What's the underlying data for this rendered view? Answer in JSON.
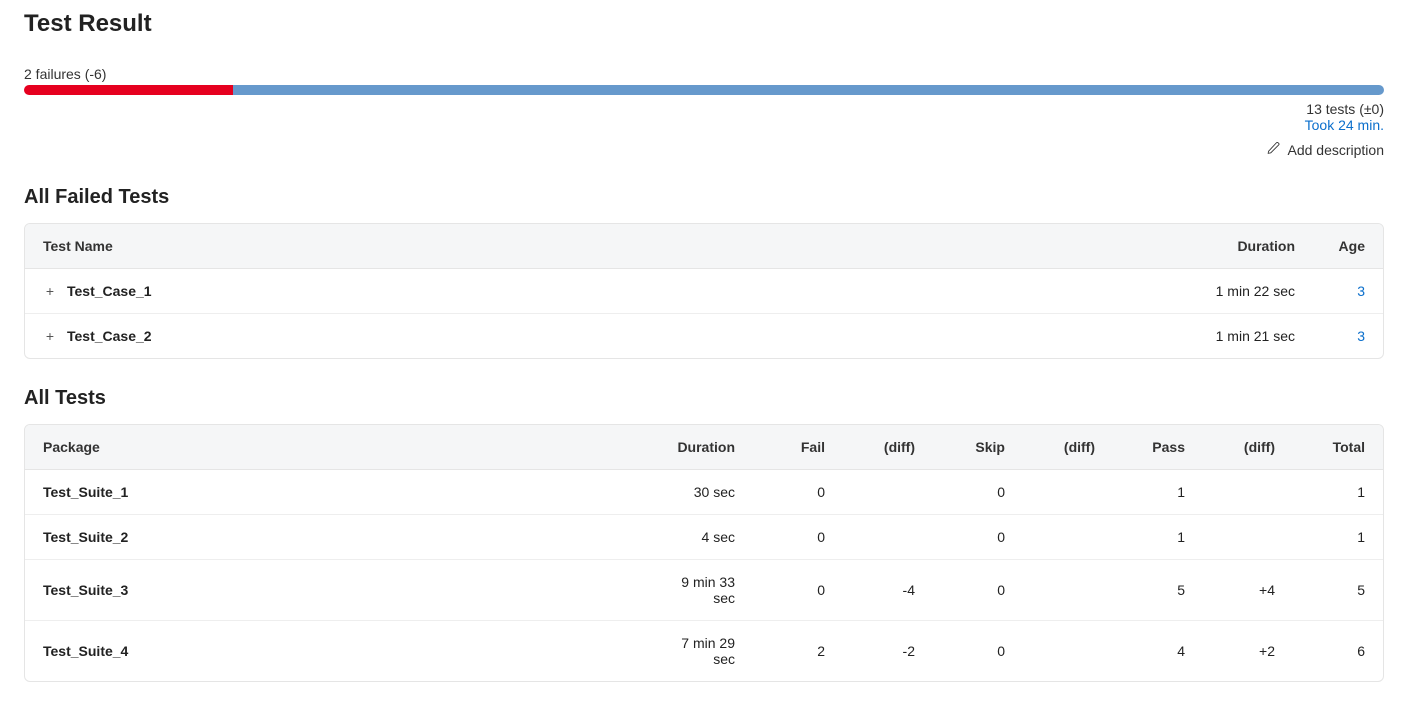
{
  "pageTitle": "Test Result",
  "summary": {
    "failuresLabel": "2 failures (-6)",
    "failPercent": 15.4,
    "testsLabel": "13 tests (±0)",
    "tookLabel": "Took 24 min.",
    "addDescription": "Add description"
  },
  "failedSection": {
    "heading": "All Failed Tests",
    "columns": {
      "name": "Test Name",
      "duration": "Duration",
      "age": "Age"
    },
    "rows": [
      {
        "name": "Test_Case_1",
        "duration": "1 min 22 sec",
        "age": "3"
      },
      {
        "name": "Test_Case_2",
        "duration": "1 min 21 sec",
        "age": "3"
      }
    ]
  },
  "allSection": {
    "heading": "All Tests",
    "columns": {
      "package": "Package",
      "duration": "Duration",
      "fail": "Fail",
      "failDiff": "(diff)",
      "skip": "Skip",
      "skipDiff": "(diff)",
      "pass": "Pass",
      "passDiff": "(diff)",
      "total": "Total"
    },
    "rows": [
      {
        "package": "Test_Suite_1",
        "duration": "30 sec",
        "fail": "0",
        "failDiff": "",
        "skip": "0",
        "skipDiff": "",
        "pass": "1",
        "passDiff": "",
        "total": "1"
      },
      {
        "package": "Test_Suite_2",
        "duration": "4 sec",
        "fail": "0",
        "failDiff": "",
        "skip": "0",
        "skipDiff": "",
        "pass": "1",
        "passDiff": "",
        "total": "1"
      },
      {
        "package": "Test_Suite_3",
        "duration": "9 min 33 sec",
        "fail": "0",
        "failDiff": "-4",
        "skip": "0",
        "skipDiff": "",
        "pass": "5",
        "passDiff": "+4",
        "total": "5"
      },
      {
        "package": "Test_Suite_4",
        "duration": "7 min 29 sec",
        "fail": "2",
        "failDiff": "-2",
        "skip": "0",
        "skipDiff": "",
        "pass": "4",
        "passDiff": "+2",
        "total": "6"
      }
    ]
  }
}
